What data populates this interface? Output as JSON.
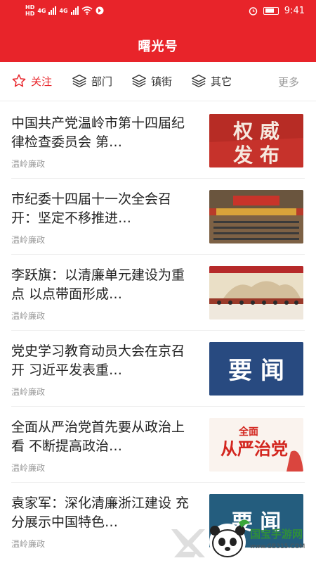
{
  "status_bar": {
    "time": "9:41",
    "network_1": "HD",
    "network_2": "HD",
    "signal_1": "4G",
    "signal_2": "4G"
  },
  "header": {
    "title": "曙光号"
  },
  "tabs": [
    {
      "label": "关注",
      "icon": "star-icon",
      "active": true
    },
    {
      "label": "部门",
      "icon": "layers-icon",
      "active": false
    },
    {
      "label": "镇街",
      "icon": "layers-icon",
      "active": false
    },
    {
      "label": "其它",
      "icon": "layers-icon",
      "active": false
    }
  ],
  "more_label": "更多",
  "news": [
    {
      "title": "中国共产党温岭市第十四届纪律检查委员会 第…",
      "source": "温岭廉政",
      "thumb_text": "权威发布"
    },
    {
      "title": "市纪委十四届十一次全会召开：坚定不移推进…",
      "source": "温岭廉政",
      "thumb_text": ""
    },
    {
      "title": "李跃旗：以清廉单元建设为重点 以点带面形成…",
      "source": "温岭廉政",
      "thumb_text": ""
    },
    {
      "title": "党史学习教育动员大会在京召开 习近平发表重…",
      "source": "温岭廉政",
      "thumb_text": "要闻"
    },
    {
      "title": "全面从严治党首先要从政治上看 不断提高政治…",
      "source": "温岭廉政",
      "thumb_text": "全面从严治党"
    },
    {
      "title": "袁家军：深化清廉浙江建设 充分展示中国特色…",
      "source": "温岭廉政",
      "thumb_text": "要闻"
    }
  ],
  "watermark": {
    "brand": "国宝手游网",
    "url": "www.GB315.COM"
  },
  "colors": {
    "brand_red": "#e8242a"
  }
}
